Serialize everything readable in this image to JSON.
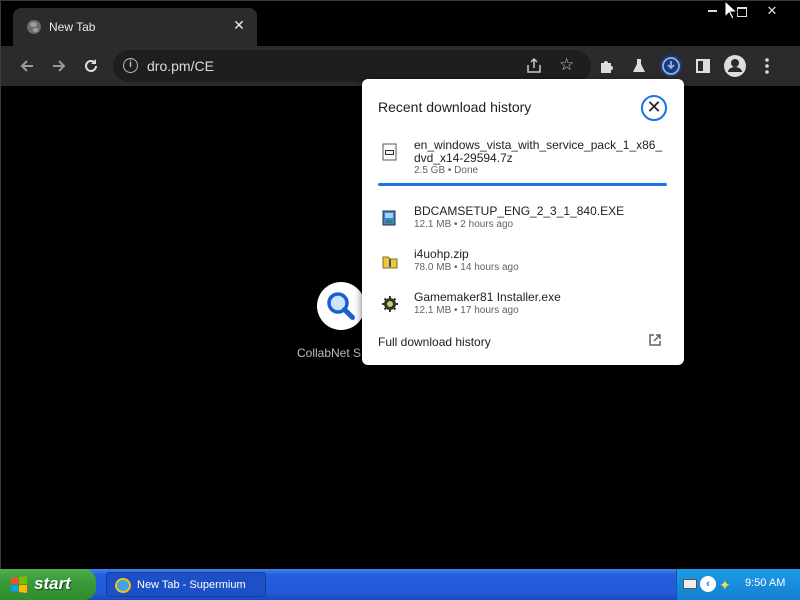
{
  "browser": {
    "tab": {
      "title": "New Tab"
    },
    "omnibox": {
      "url": "dro.pm/CE"
    },
    "new_tab_page": {
      "caption": "CollabNet S"
    }
  },
  "downloads_popup": {
    "heading": "Recent download history",
    "items": [
      {
        "name": "en_windows_vista_with_service_pack_1_x86_dvd_x14-29594.7z",
        "meta": "2.5 GB • Done",
        "progress": 1.0
      },
      {
        "name": "BDCAMSETUP_ENG_2_3_1_840.EXE",
        "meta": "12.1 MB • 2 hours ago"
      },
      {
        "name": "i4uohp.zip",
        "meta": "78.0 MB • 14 hours ago"
      },
      {
        "name": "Gamemaker81 Installer.exe",
        "meta": "12.1 MB • 17 hours ago"
      }
    ],
    "footer_link": "Full download history"
  },
  "taskbar": {
    "start_label": "start",
    "task_button": "New Tab - Supermium",
    "clock": "9:50 AM"
  },
  "colors": {
    "accent": "#1a73e8",
    "taskbar_blue": "#245edc",
    "start_green": "#3b9a3b"
  }
}
